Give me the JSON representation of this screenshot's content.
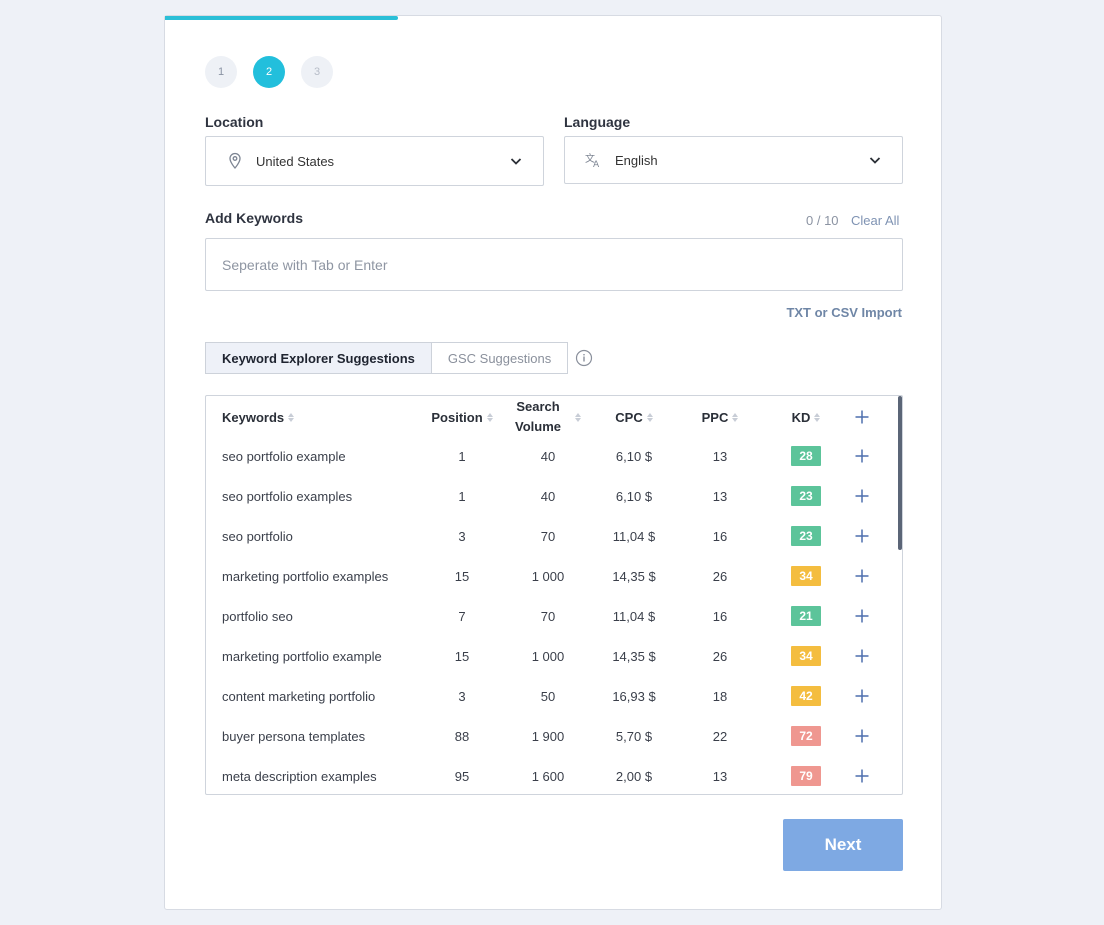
{
  "progress": {
    "fraction": 0.3
  },
  "steps": [
    {
      "label": "1",
      "state": "done"
    },
    {
      "label": "2",
      "state": "active"
    },
    {
      "label": "3",
      "state": "future"
    }
  ],
  "location": {
    "label": "Location",
    "value": "United States",
    "icon": "location-pin-icon"
  },
  "language": {
    "label": "Language",
    "value": "English",
    "icon": "translate-icon"
  },
  "keywords": {
    "label": "Add Keywords",
    "count": "0 / 10",
    "clear_label": "Clear All",
    "placeholder": "Seperate with Tab or Enter",
    "import_label": "TXT or CSV Import"
  },
  "tabs": [
    {
      "label": "Keyword Explorer Suggestions",
      "active": true
    },
    {
      "label": "GSC Suggestions",
      "active": false
    }
  ],
  "table": {
    "headers": {
      "keyword": "Keywords",
      "position": "Position",
      "volume_1": "Search",
      "volume_2": "Volume",
      "cpc": "CPC",
      "ppc": "PPC",
      "kd": "KD"
    },
    "rows": [
      {
        "keyword": "seo portfolio example",
        "position": "1",
        "volume": "40",
        "cpc": "6,10 $",
        "ppc": "13",
        "kd": "28",
        "kd_color": "#5cc49a"
      },
      {
        "keyword": "seo portfolio examples",
        "position": "1",
        "volume": "40",
        "cpc": "6,10 $",
        "ppc": "13",
        "kd": "23",
        "kd_color": "#5cc49a"
      },
      {
        "keyword": "seo portfolio",
        "position": "3",
        "volume": "70",
        "cpc": "11,04 $",
        "ppc": "16",
        "kd": "23",
        "kd_color": "#5cc49a"
      },
      {
        "keyword": "marketing portfolio examples",
        "position": "15",
        "volume": "1 000",
        "cpc": "14,35 $",
        "ppc": "26",
        "kd": "34",
        "kd_color": "#f4bd3f"
      },
      {
        "keyword": "portfolio seo",
        "position": "7",
        "volume": "70",
        "cpc": "11,04 $",
        "ppc": "16",
        "kd": "21",
        "kd_color": "#5cc49a"
      },
      {
        "keyword": "marketing portfolio example",
        "position": "15",
        "volume": "1 000",
        "cpc": "14,35 $",
        "ppc": "26",
        "kd": "34",
        "kd_color": "#f4bd3f"
      },
      {
        "keyword": "content marketing portfolio",
        "position": "3",
        "volume": "50",
        "cpc": "16,93 $",
        "ppc": "18",
        "kd": "42",
        "kd_color": "#f4bd3f"
      },
      {
        "keyword": "buyer persona templates",
        "position": "88",
        "volume": "1 900",
        "cpc": "5,70 $",
        "ppc": "22",
        "kd": "72",
        "kd_color": "#ef9790"
      },
      {
        "keyword": "meta description examples",
        "position": "95",
        "volume": "1 600",
        "cpc": "2,00 $",
        "ppc": "13",
        "kd": "79",
        "kd_color": "#ef9790"
      }
    ]
  },
  "next_label": "Next",
  "colors": {
    "accent": "#22bfdc",
    "next_button": "#7ea9e3",
    "link": "#7f93b3"
  }
}
